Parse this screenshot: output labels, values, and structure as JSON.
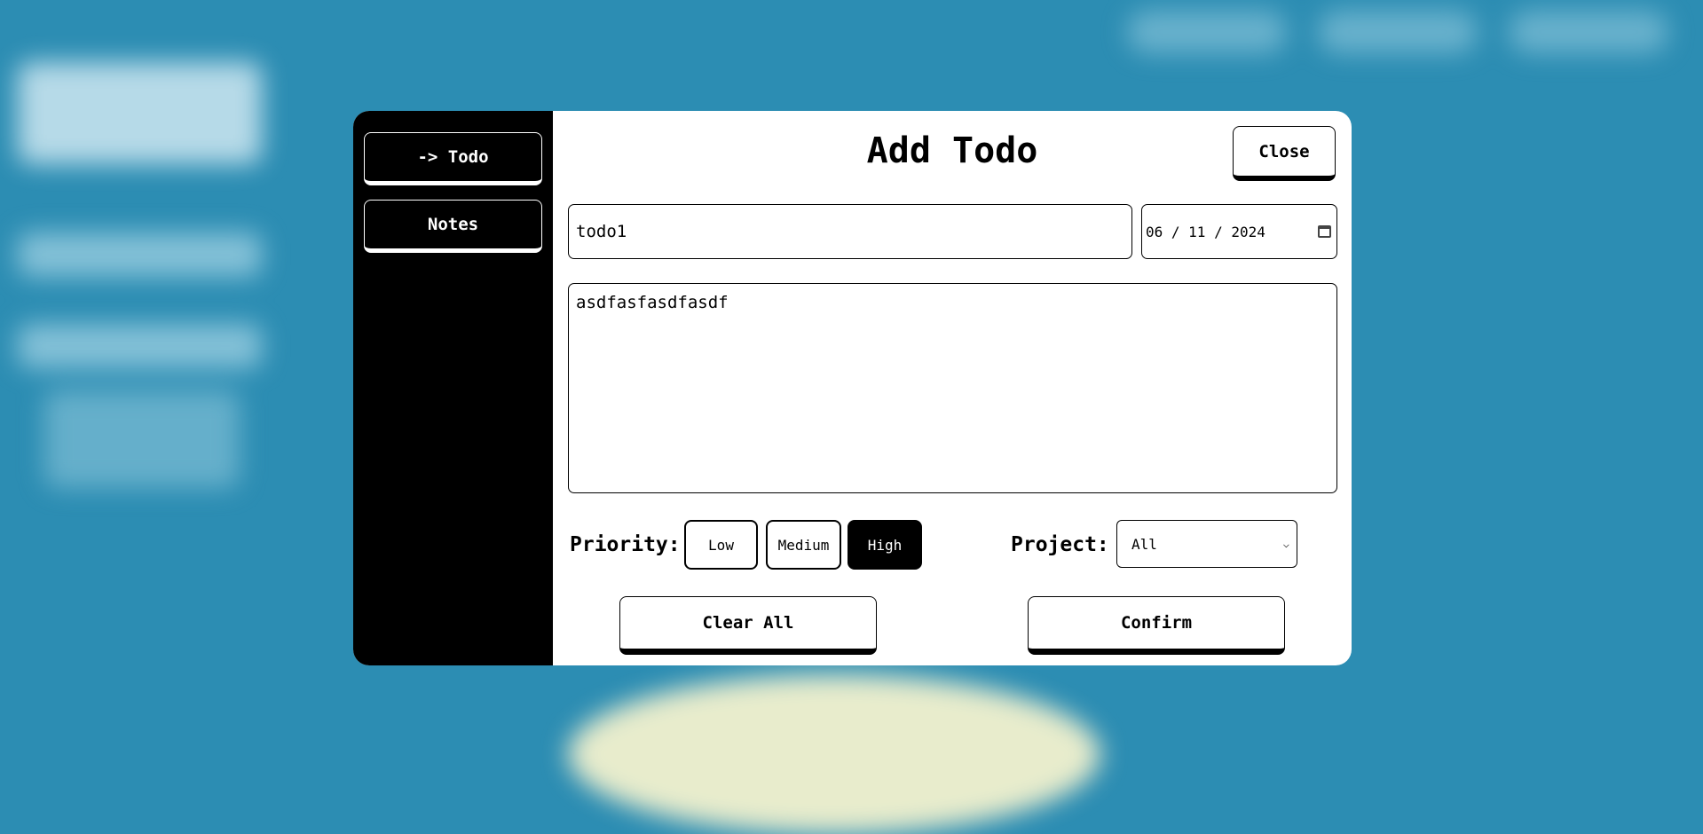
{
  "sidebar": {
    "items": [
      {
        "label": "-> Todo"
      },
      {
        "label": "Notes"
      }
    ]
  },
  "modal": {
    "title": "Add Todo",
    "close_label": "Close"
  },
  "form": {
    "name_value": "todo1",
    "date_value": "06 / 11 / 2024",
    "description_value": "asdfasfasdfasdf",
    "priority_label": "Priority:",
    "priority_options": [
      "Low",
      "Medium",
      "High"
    ],
    "priority_selected": "High",
    "project_label": "Project:",
    "project_value": "All"
  },
  "actions": {
    "clear_label": "Clear All",
    "confirm_label": "Confirm"
  }
}
